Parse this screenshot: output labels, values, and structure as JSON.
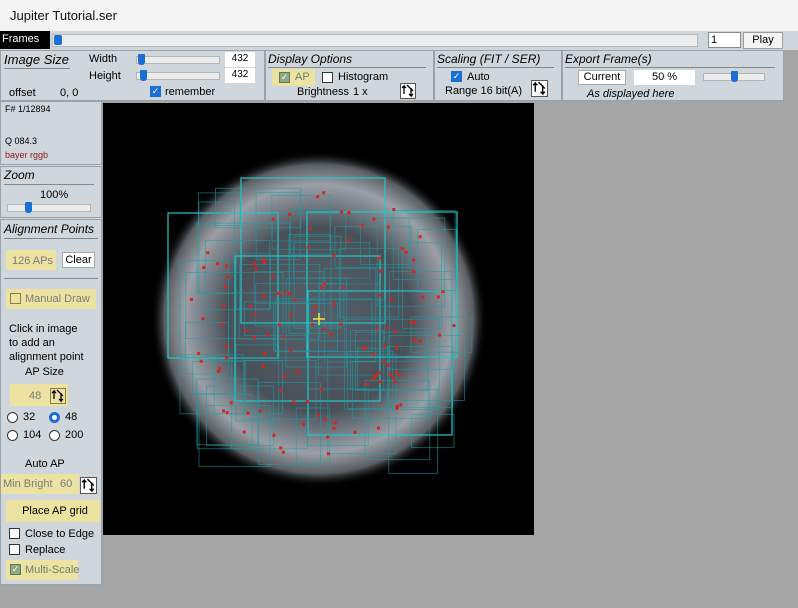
{
  "window": {
    "title": "Jupiter Tutorial.ser"
  },
  "frames": {
    "label": "Frames",
    "current": "1",
    "play_label": "Play",
    "position_fraction": 0.0
  },
  "image_size": {
    "title": "Image Size",
    "width_label": "Width",
    "width_value": "432",
    "height_label": "Height",
    "height_value": "432",
    "offset_label": "offset",
    "offset_value": "0, 0",
    "remember_label": "remember",
    "remember_checked": true
  },
  "display_options": {
    "title": "Display Options",
    "ap_label": "AP",
    "ap_checked": true,
    "histogram_label": "Histogram",
    "histogram_checked": false,
    "brightness_label": "Brightness",
    "brightness_value": "1 x"
  },
  "scaling": {
    "title": "Scaling (FIT / SER)",
    "auto_label": "Auto",
    "auto_checked": true,
    "range_label": "Range 16 bit(A)"
  },
  "export": {
    "title": "Export Frame(s)",
    "current_label": "Current",
    "percent_value": "50 %",
    "displayed_label": "As displayed here"
  },
  "info": {
    "frame_number": "F# 1/12894",
    "quality": "Q  084.3",
    "bayer": "bayer rggb"
  },
  "zoom": {
    "title": "Zoom",
    "value": "100%"
  },
  "alignment": {
    "title": "Alignment Points",
    "ap_count": "126 APs",
    "clear_label": "Clear",
    "manual_draw_label": "Manual Draw",
    "instructions": [
      "Click in image",
      "to add an",
      "alignment point"
    ],
    "ap_size_label": "AP Size",
    "ap_size_value": "48",
    "size_options": [
      "32",
      "48",
      "104",
      "200"
    ],
    "size_selected": "48",
    "auto_ap_label": "Auto AP",
    "min_bright_label": "Min Bright",
    "min_bright_value": "60",
    "place_grid_label": "Place AP grid",
    "close_to_edge_label": "Close to Edge",
    "replace_label": "Replace",
    "multi_scale_label": "Multi-Scale"
  },
  "colors": {
    "accent": "#1a6fd6",
    "panel": "#cfd6dc",
    "ap_box": "#25c8c8",
    "ap_point": "#e0201c",
    "crosshair": "#f0e040",
    "highlight": "#ece3a2"
  }
}
